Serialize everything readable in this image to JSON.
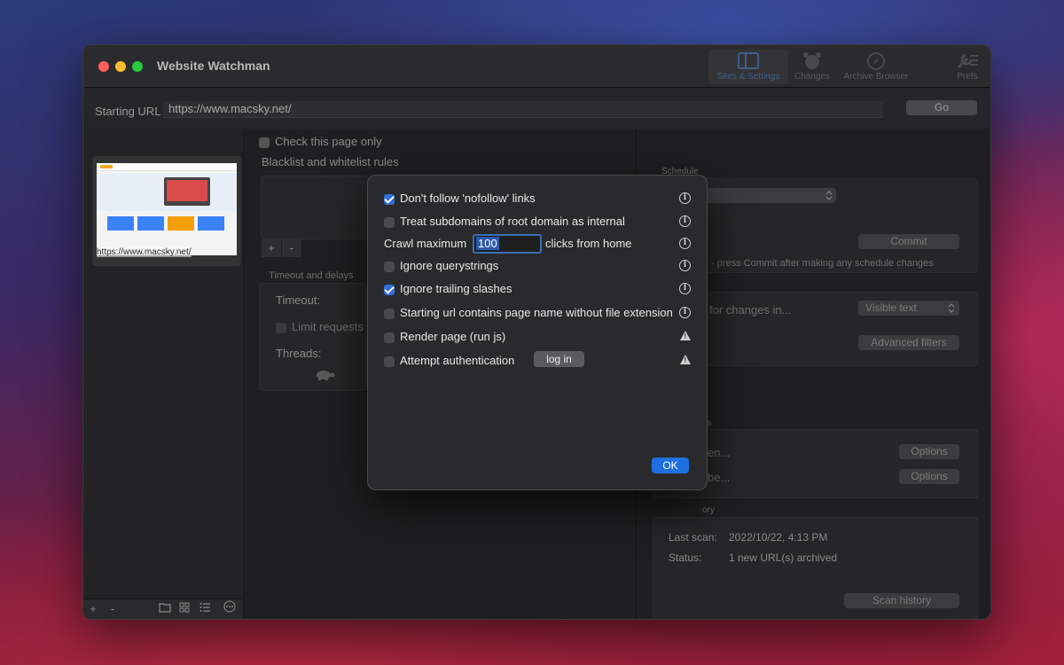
{
  "window": {
    "title": "Website Watchman",
    "toolbar": [
      {
        "label": "Sites & Settings",
        "icon": "sidebar-panel-icon"
      },
      {
        "label": "Changes",
        "icon": "alarm-clock-icon"
      },
      {
        "label": "Archive Browser",
        "icon": "compass-icon"
      },
      {
        "label": "Prefs",
        "icon": "wrench-icon"
      }
    ]
  },
  "url_bar": {
    "label": "Starting URL",
    "value": "https://www.macsky.net/",
    "go_label": "Go"
  },
  "sidebar": {
    "site_thumb_url": "https://www.macsky.net/",
    "add_label": "+",
    "remove_label": "-"
  },
  "main": {
    "check_page_only_label": "Check this page only",
    "blacklist_label": "Blacklist and whitelist rules",
    "add_rule": "+",
    "remove_rule": "-",
    "timeout_section": "Timeout and delays",
    "timeout_label": "Timeout:",
    "limit_requests_label": "Limit requests t",
    "threads_label": "Threads:"
  },
  "right": {
    "schedule_label": "Schedule",
    "commit_label": "Commit",
    "commit_hint": "- press Commit after making any schedule changes",
    "check_changes_label": "for changes in...",
    "check_changes_select": "Visible text",
    "advanced_filters": "Advanced filters",
    "section2_partial": "ns",
    "when_partial": "en...",
    "be_partial": "be...",
    "options_label": "Options",
    "history_partial": "ory",
    "last_scan_label": "Last scan:",
    "last_scan_value": "2022/10/22, 4:13 PM",
    "status_label": "Status:",
    "status_value": "1 new URL(s) archived",
    "scan_history": "Scan history"
  },
  "sheet": {
    "nofollow": "Don't follow 'nofollow' links",
    "subdomains": "Treat subdomains of root domain as internal",
    "crawl_max_label": "Crawl maximum",
    "crawl_max_value": "100",
    "crawl_max_suffix": "clicks from home",
    "ignore_querystrings": "Ignore querystrings",
    "ignore_trailing": "Ignore trailing slashes",
    "starting_url_page": "Starting url contains page name without file extension",
    "render_page": "Render page (run js)",
    "attempt_auth": "Attempt authentication",
    "login_label": "log in",
    "ok_label": "OK",
    "info_glyph": "i",
    "warn_glyph": "!"
  },
  "colors": {
    "accent": "#2f6fdc",
    "ok_button": "#1f6fe0"
  }
}
